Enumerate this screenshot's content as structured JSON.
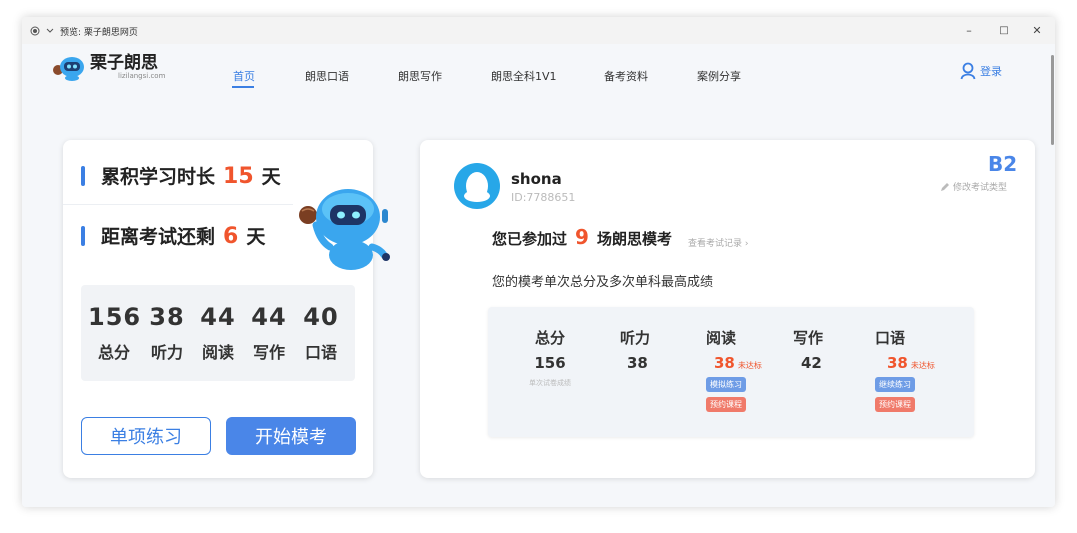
{
  "window": {
    "title": "预览: 栗子朗思网页",
    "controls": {
      "minimize": "–",
      "maximize": "□",
      "close": "✕"
    }
  },
  "brand": {
    "name": "栗子朗思",
    "domain": "lizilangsi.com"
  },
  "nav": {
    "items": [
      "首页",
      "朗思口语",
      "朗思写作",
      "朗思全科1V1",
      "备考资料",
      "案例分享"
    ],
    "active": "首页",
    "login_label": "登录"
  },
  "left_card": {
    "study_prefix": "累积学习时长",
    "study_days": "15",
    "study_unit": "天",
    "exam_prefix": "距离考试还剩",
    "exam_days": "6",
    "exam_unit": "天",
    "scores": [
      {
        "value": "156",
        "label": "总分"
      },
      {
        "value": "38",
        "label": "听力"
      },
      {
        "value": "44",
        "label": "阅读"
      },
      {
        "value": "44",
        "label": "写作"
      },
      {
        "value": "40",
        "label": "口语"
      }
    ],
    "btn_single": "单项练习",
    "btn_mock": "开始模考"
  },
  "right_card": {
    "username": "shona",
    "user_id": "ID:7788651",
    "level": "B2",
    "edit_label": "修改考试类型",
    "attended_prefix": "您已参加过",
    "attended_count": "9",
    "attended_suffix": "场朗思模考",
    "history_link": "查看考试记录 ›",
    "summary": "您的模考单次总分及多次单科最高成绩",
    "table": {
      "total": {
        "head": "总分",
        "value": "156",
        "note": "单次试卷成绩"
      },
      "listening": {
        "head": "听力",
        "value": "38"
      },
      "reading": {
        "head": "阅读",
        "value": "38",
        "tag": "未达标",
        "chip1": "模拟练习",
        "chip2": "预约课程"
      },
      "writing": {
        "head": "写作",
        "value": "42"
      },
      "speaking": {
        "head": "口语",
        "value": "38",
        "tag": "未达标",
        "chip1": "继续练习",
        "chip2": "预约课程"
      }
    }
  },
  "colors": {
    "accent": "#3b7fe3",
    "highlight": "#f0552d",
    "panel": "#f1f3f6"
  }
}
